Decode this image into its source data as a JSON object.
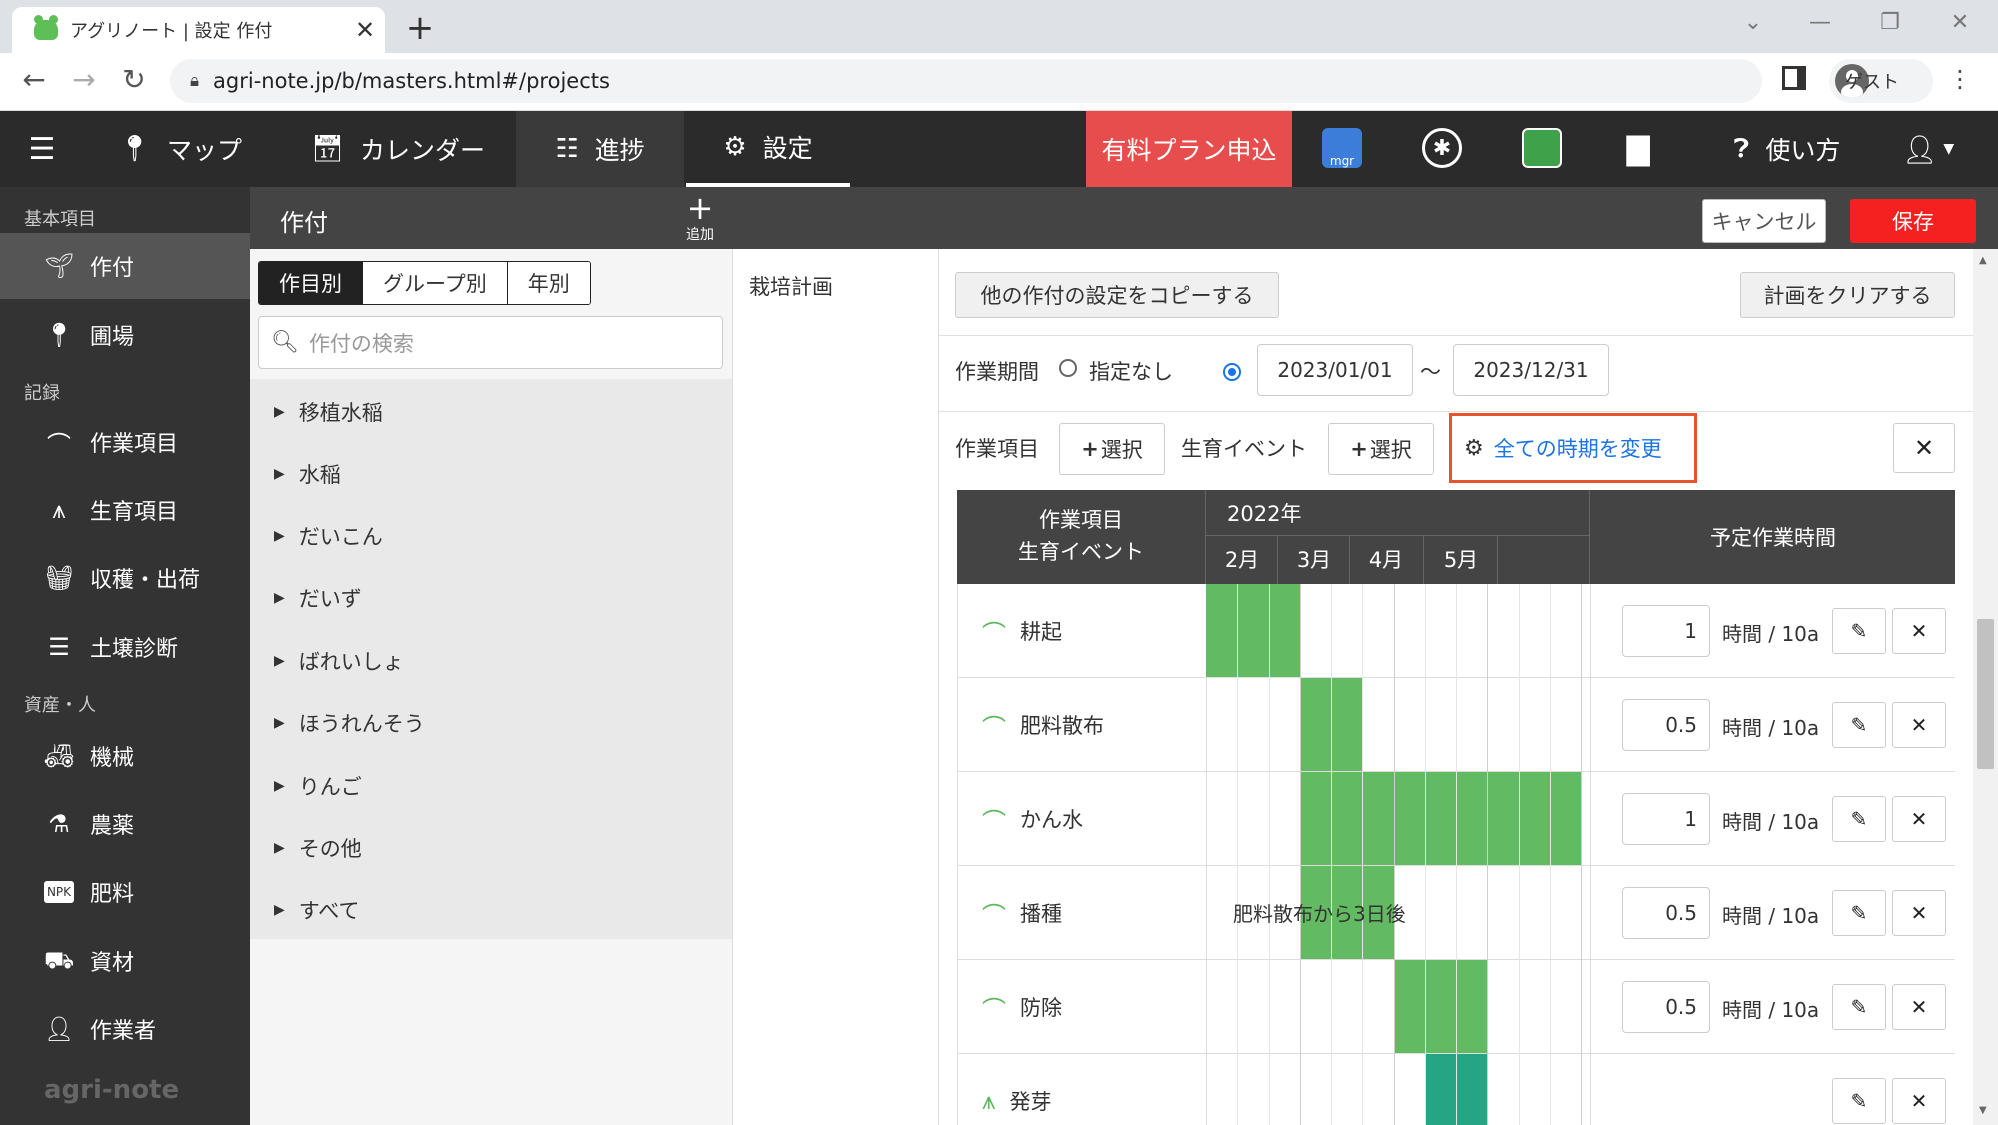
{
  "browser": {
    "tab_title": "アグリノート | 設定 作付",
    "url": "agri-note.jp/b/masters.html#/projects",
    "guest_label": "ゲスト"
  },
  "nav": {
    "map": "マップ",
    "calendar": "カレンダー",
    "progress": "進捗",
    "settings": "設定",
    "paid_plan": "有料プラン申込",
    "help": "使い方",
    "mgr": "mgr"
  },
  "sidebar": {
    "sec_basic": "基本項目",
    "sec_record": "記録",
    "sec_assets": "資産・人",
    "items": [
      "作付",
      "圃場",
      "作業項目",
      "生育項目",
      "収穫・出荷",
      "土壌診断",
      "機械",
      "農薬",
      "肥料",
      "資材",
      "作業者"
    ],
    "logo": "agri-note"
  },
  "header": {
    "title": "作付",
    "add_label": "追加",
    "cancel": "キャンセル",
    "save": "保存"
  },
  "list": {
    "segments": [
      "作目別",
      "グループ別",
      "年別"
    ],
    "search_placeholder": "作付の検索",
    "crops": [
      "移植水稲",
      "水稲",
      "だいこん",
      "だいず",
      "ばれいしょ",
      "ほうれんそう",
      "りんご",
      "その他",
      "すべて"
    ]
  },
  "middle": {
    "label": "栽培計画"
  },
  "plan": {
    "copy_button": "他の作付の設定をコピーする",
    "clear_button": "計画をクリアする",
    "period_label": "作業期間",
    "none_label": "指定なし",
    "start_date": "2023/01/01",
    "tilde": "〜",
    "end_date": "2023/12/31",
    "task_label": "作業項目",
    "select_label": "選択",
    "event_label": "生育イベント",
    "all_change": "全ての時期を変更"
  },
  "table": {
    "col1_line1": "作業項目",
    "col1_line2": "生育イベント",
    "year": "2022年",
    "months": [
      "2月",
      "3月",
      "4月",
      "5月"
    ],
    "time_header": "予定作業時間",
    "unit": "時間 / 10a",
    "rows": [
      {
        "name": "耕起",
        "hours": "1",
        "type": "task"
      },
      {
        "name": "肥料散布",
        "hours": "0.5",
        "type": "task"
      },
      {
        "name": "かん水",
        "hours": "1",
        "type": "task"
      },
      {
        "name": "播種",
        "hours": "0.5",
        "type": "task",
        "note": "肥料散布から3日後"
      },
      {
        "name": "防除",
        "hours": "0.5",
        "type": "task"
      },
      {
        "name": "発芽",
        "hours": "",
        "type": "event"
      }
    ]
  },
  "colors": {
    "accent_red": "#f52020",
    "paid": "#e84d4d",
    "bar": "#62bb62",
    "event_bar": "#26a585",
    "highlight": "#e8532e",
    "link": "#1a73e8"
  }
}
